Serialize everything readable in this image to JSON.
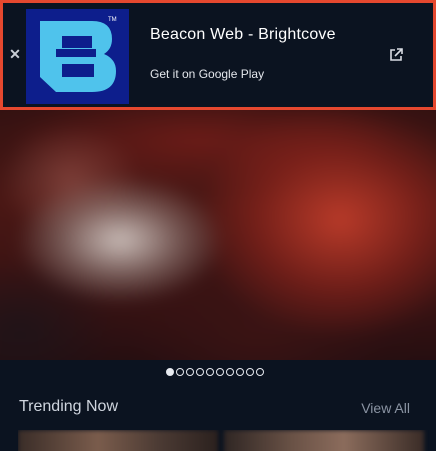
{
  "banner": {
    "close_icon": "close-icon",
    "app_icon": "beacon-b-logo-icon",
    "app_title": "Beacon Web - Brightcove",
    "app_subtitle": "Get it on Google Play",
    "open_icon": "external-link-icon",
    "border_color": "#e5482f",
    "icon_bg_color": "#0d1e8c",
    "icon_fg_color": "#4fc3ec"
  },
  "hero": {
    "slide_count": 10,
    "active_slide": 1
  },
  "trending": {
    "title": "Trending Now",
    "view_all_label": "View All"
  }
}
